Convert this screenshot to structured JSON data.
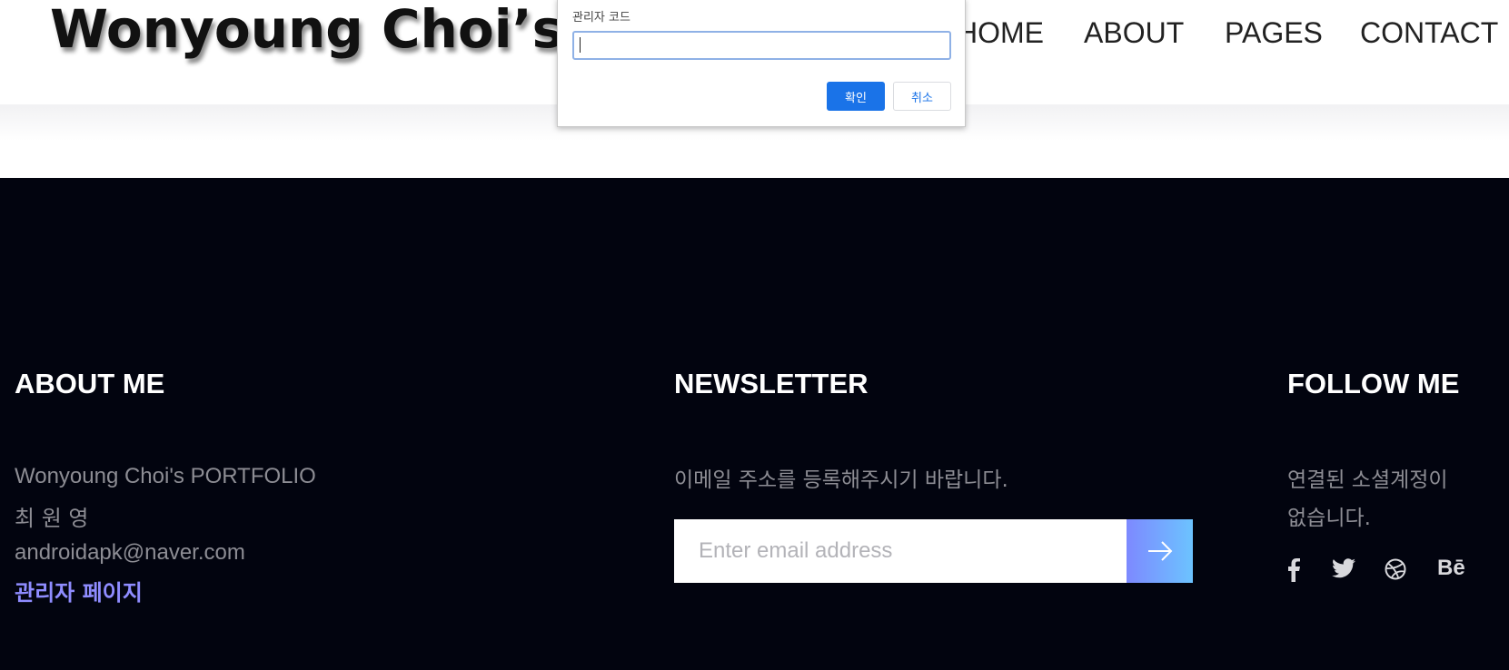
{
  "header": {
    "logo_text": "Wonyoung Choi’s PORTFOLIO",
    "nav": [
      {
        "label": "HOME"
      },
      {
        "label": "ABOUT"
      },
      {
        "label": "PAGES"
      },
      {
        "label": "CONTACT"
      }
    ]
  },
  "dialog": {
    "message": "관리자 코드",
    "input_value": "",
    "ok_label": "확인",
    "cancel_label": "취소"
  },
  "footer": {
    "about": {
      "title": "ABOUT ME",
      "lines": [
        "Wonyoung Choi's PORTFOLIO",
        "최 원 영",
        "androidapk@naver.com"
      ],
      "admin_link": "관리자 페이지"
    },
    "newsletter": {
      "title": "NEWSLETTER",
      "description": "이메일 주소를 등록해주시기 바랍니다.",
      "email_placeholder": "Enter email address"
    },
    "follow": {
      "title": "FOLLOW ME",
      "line1": "연결된 소셜계정이",
      "line2": "없습니다.",
      "icons": [
        "facebook-icon",
        "twitter-icon",
        "dribbble-icon",
        "behance-icon"
      ],
      "behance_text": "Bē"
    }
  },
  "colors": {
    "footer_bg": "#02040f",
    "accent": "#1a73e8",
    "admin_link": "#8f8cff",
    "button_gradient_start": "#7d89ff",
    "button_gradient_end": "#6cc3ff"
  }
}
